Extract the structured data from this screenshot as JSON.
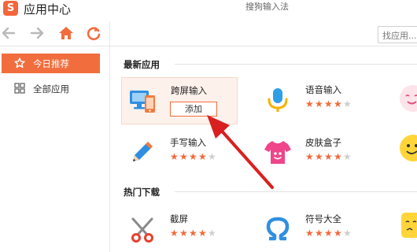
{
  "window": {
    "logo": "S",
    "title": "应用中心",
    "subtitle": "搜狗输入法"
  },
  "toolbar": {
    "search_placeholder": "找应用..."
  },
  "sidebar": {
    "items": [
      {
        "label": "今日推荐",
        "icon": "star-icon",
        "active": true
      },
      {
        "label": "全部应用",
        "icon": "grid-icon",
        "active": false
      }
    ]
  },
  "sections": {
    "new": {
      "title": "最新应用",
      "apps": [
        {
          "name": "跨屏输入",
          "icon": "cross-screen-icon",
          "rating": 4,
          "add_label": "添加"
        },
        {
          "name": "语音输入",
          "icon": "microphone-icon",
          "rating": 4
        },
        {
          "name": "手写输入",
          "icon": "pencil-icon",
          "rating": 4
        },
        {
          "name": "皮肤盒子",
          "icon": "tshirt-icon",
          "rating": 4
        }
      ]
    },
    "hot": {
      "title": "热门下载",
      "apps": [
        {
          "name": "截屏",
          "icon": "scissors-icon",
          "rating": 4
        },
        {
          "name": "符号大全",
          "icon": "omega-icon",
          "rating": 4
        }
      ]
    }
  },
  "colors": {
    "accent": "#f26d3d",
    "star_on": "#f06a3a",
    "star_off": "#cfcfcf",
    "arrow": "#d92020"
  }
}
